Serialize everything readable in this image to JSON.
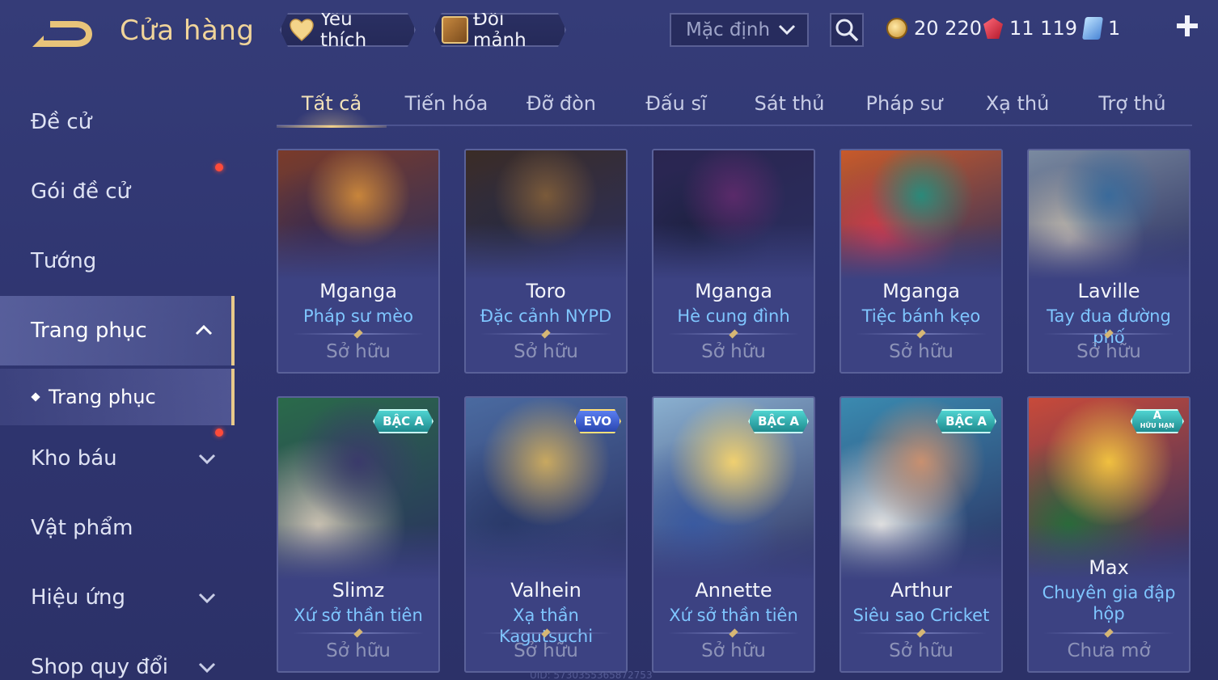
{
  "header": {
    "title": "Cửa hàng",
    "favorites_label": "Yêu thích",
    "trade_label": "Đổi mảnh",
    "sort_value": "Mặc định",
    "currency": {
      "gold": "20 220",
      "gems": "11 119",
      "cards": "1"
    }
  },
  "sidebar": {
    "items": [
      {
        "label": "Đề cử"
      },
      {
        "label": "Gói đề cử"
      },
      {
        "label": "Tướng"
      },
      {
        "label": "Trang phục"
      },
      {
        "label": "Trang phục"
      },
      {
        "label": "Kho báu"
      },
      {
        "label": "Vật phẩm"
      },
      {
        "label": "Hiệu ứng"
      },
      {
        "label": "Shop quy đổi"
      }
    ]
  },
  "tabs": [
    {
      "label": "Tất cả"
    },
    {
      "label": "Tiến hóa"
    },
    {
      "label": "Đỡ đòn"
    },
    {
      "label": "Đấu sĩ"
    },
    {
      "label": "Sát thủ"
    },
    {
      "label": "Pháp sư"
    },
    {
      "label": "Xạ thủ"
    },
    {
      "label": "Trợ thủ"
    }
  ],
  "cards": [
    {
      "hero": "Mganga",
      "skin": "Pháp sư mèo",
      "status": "Sở hữu",
      "colors": [
        "#7a3b2a",
        "#c8853b",
        "#3d2a4a"
      ]
    },
    {
      "hero": "Toro",
      "skin": "Đặc cảnh NYPD",
      "status": "Sở hữu",
      "colors": [
        "#3a2c26",
        "#7a5a3a",
        "#2a2a3a"
      ]
    },
    {
      "hero": "Mganga",
      "skin": "Hè cung đình",
      "status": "Sở hữu",
      "colors": [
        "#2a2550",
        "#5a2a6a",
        "#1d2040"
      ]
    },
    {
      "hero": "Mganga",
      "skin": "Tiệc bánh kẹo",
      "status": "Sở hữu",
      "colors": [
        "#c85a2a",
        "#2a8a7a",
        "#d83a4a"
      ]
    },
    {
      "hero": "Laville",
      "skin": "Tay đua đường phố",
      "status": "Sở hữu",
      "colors": [
        "#7a8aa0",
        "#3a6a9a",
        "#c8c0b0"
      ]
    },
    {
      "hero": "Slimz",
      "skin": "Xứ sở thần tiên",
      "status": "Sở hữu",
      "badge": "BẬC A",
      "colors": [
        "#2a6a4a",
        "#3a3a6a",
        "#c8c0b0"
      ]
    },
    {
      "hero": "Valhein",
      "skin": "Xạ thần Kagutsuchi",
      "status": "Sở hữu",
      "badge": "EVO",
      "colors": [
        "#4a6aa0",
        "#c8a860",
        "#2a3a6a"
      ]
    },
    {
      "hero": "Annette",
      "skin": "Xứ sở thần tiên",
      "status": "Sở hữu",
      "badge": "BẬC A",
      "colors": [
        "#8ab0d0",
        "#f0d070",
        "#3a5aa0"
      ]
    },
    {
      "hero": "Arthur",
      "skin": "Siêu sao Cricket",
      "status": "Sở hữu",
      "badge": "BẬC A",
      "colors": [
        "#3a8ab0",
        "#c89070",
        "#e0e0e0"
      ]
    },
    {
      "hero": "Max",
      "skin": "Chuyên gia đập hộp",
      "status": "Chưa mở",
      "badge": "A",
      "badge_sub": "HỮU HẠN",
      "colors": [
        "#c84a3a",
        "#f0c040",
        "#2a6a3a"
      ]
    }
  ],
  "footer": {
    "uid": "UID: 5730355365872753"
  }
}
